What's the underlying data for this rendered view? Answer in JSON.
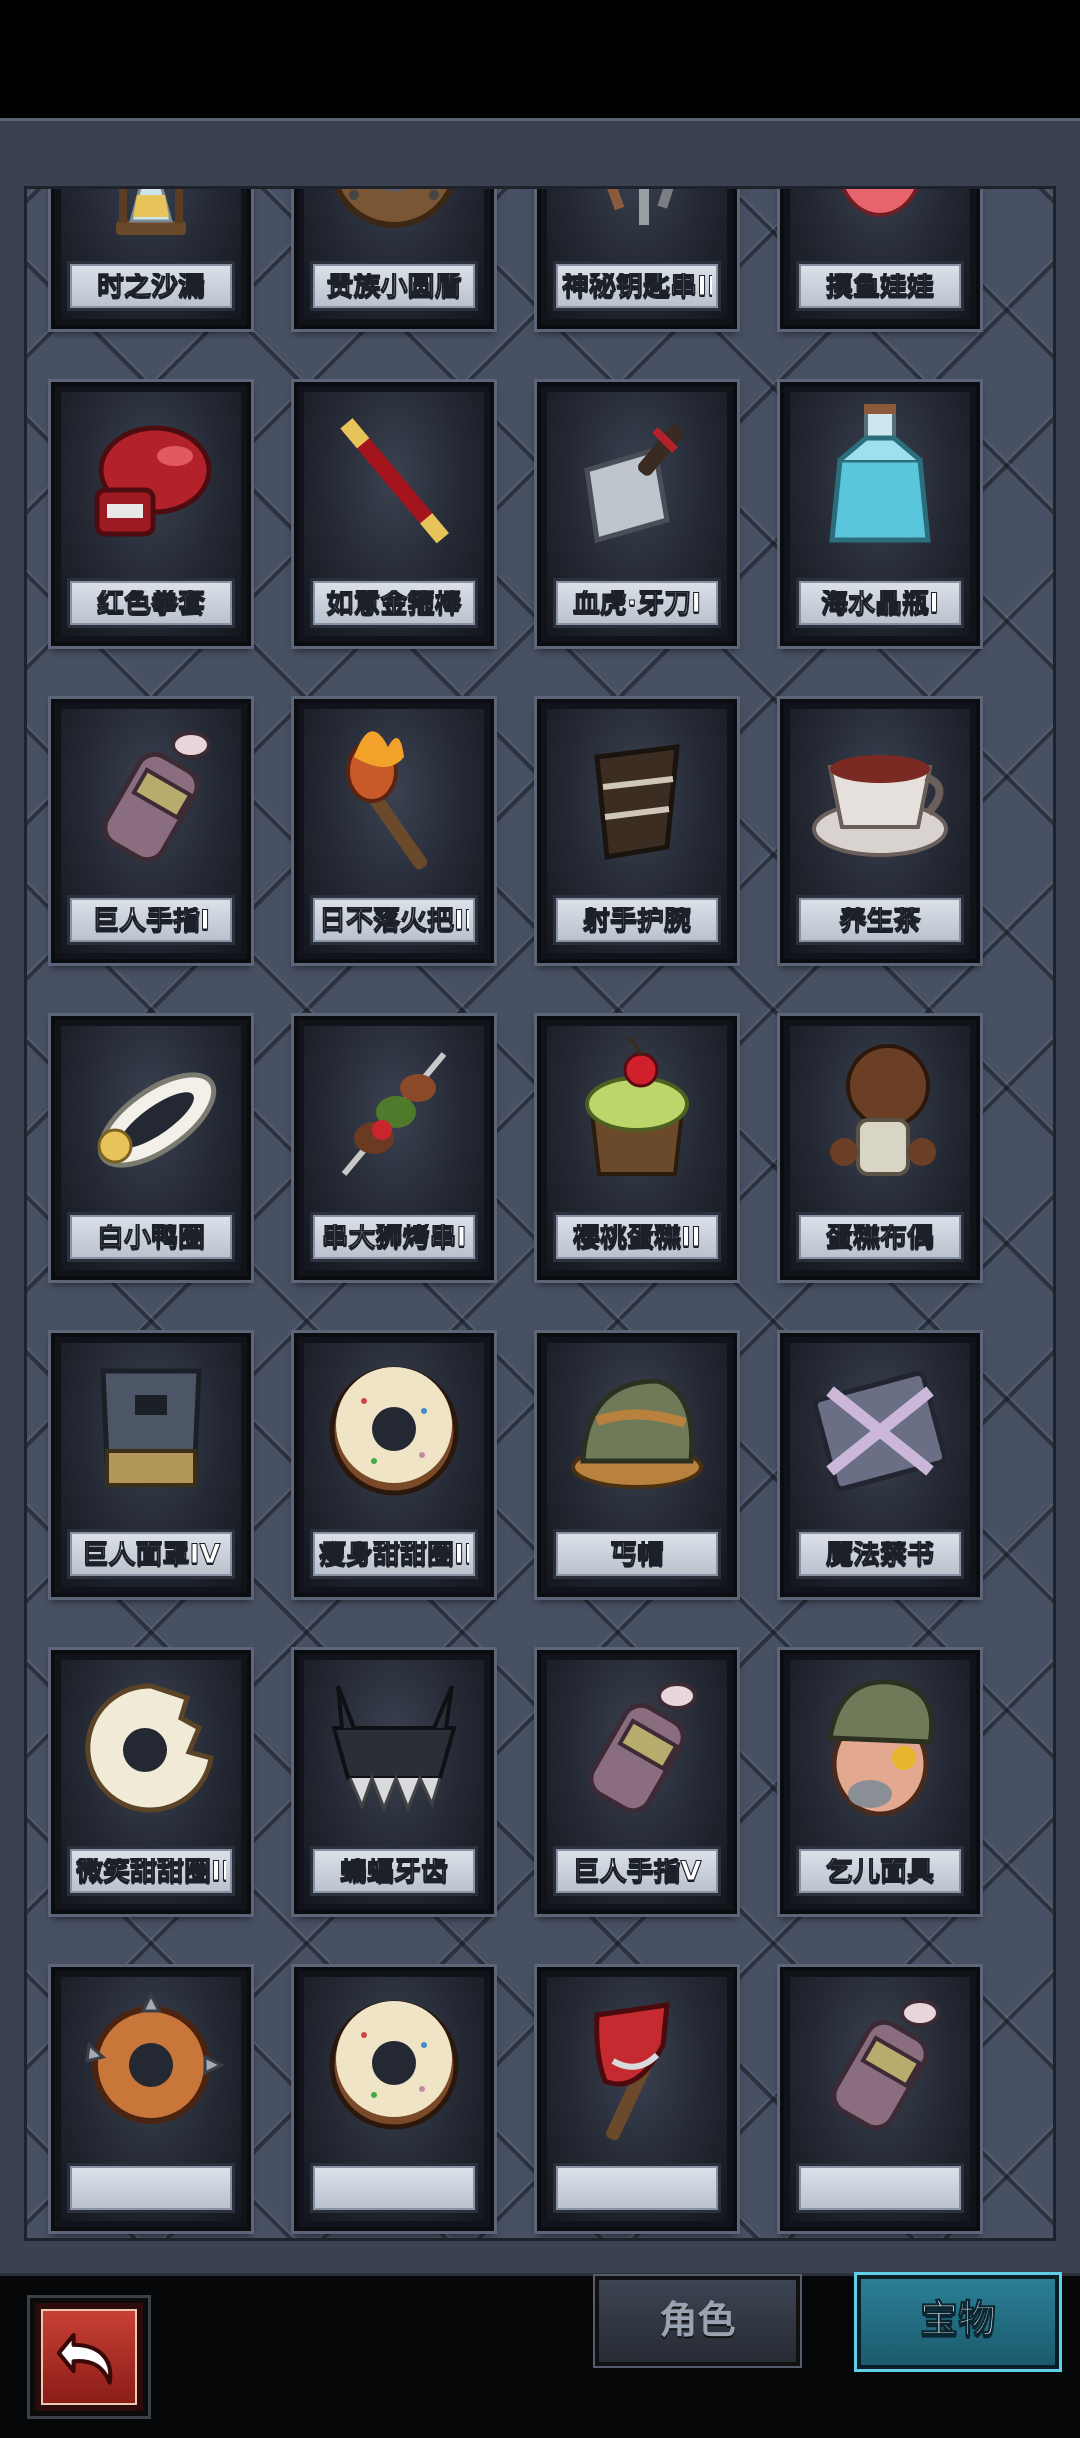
{
  "items": [
    {
      "name": "时之沙漏",
      "icon": "hourglass-icon"
    },
    {
      "name": "贵族小圆盾",
      "icon": "round-shield-icon"
    },
    {
      "name": "神秘钥匙串II",
      "icon": "key-ring-icon"
    },
    {
      "name": "摸鱼娃娃",
      "icon": "pink-doll-icon"
    },
    {
      "name": "红色拳套",
      "icon": "boxing-glove-icon"
    },
    {
      "name": "如意金箍棒",
      "icon": "staff-icon"
    },
    {
      "name": "血虎·牙刀I",
      "icon": "cleaver-icon"
    },
    {
      "name": "海水晶瓶I",
      "icon": "potion-bottle-icon"
    },
    {
      "name": "巨人手指I",
      "icon": "giant-finger-icon"
    },
    {
      "name": "日不落火把II",
      "icon": "torch-icon"
    },
    {
      "name": "射手护腕",
      "icon": "bracer-icon"
    },
    {
      "name": "养生茶",
      "icon": "teacup-icon"
    },
    {
      "name": "白小鸭圈",
      "icon": "duck-ring-icon"
    },
    {
      "name": "串大狮烤串I",
      "icon": "skewer-icon"
    },
    {
      "name": "樱桃蛋糕II",
      "icon": "cherry-cake-icon"
    },
    {
      "name": "蛋糕布偶",
      "icon": "cake-doll-icon"
    },
    {
      "name": "巨人面罩IV",
      "icon": "giant-mask-icon"
    },
    {
      "name": "瘦身甜甜圈II",
      "icon": "donut-icon"
    },
    {
      "name": "丐帽",
      "icon": "beggar-hat-icon"
    },
    {
      "name": "魔法禁书",
      "icon": "forbidden-book-icon"
    },
    {
      "name": "微笑甜甜圈II",
      "icon": "bitten-donut-icon"
    },
    {
      "name": "蝙蝠牙齿",
      "icon": "bat-teeth-icon"
    },
    {
      "name": "巨人手指V",
      "icon": "giant-finger-icon"
    },
    {
      "name": "乞儿面具",
      "icon": "beggar-mask-icon"
    },
    {
      "name": "",
      "icon": "spiked-ring-icon"
    },
    {
      "name": "",
      "icon": "donut-icon"
    },
    {
      "name": "",
      "icon": "axe-icon"
    },
    {
      "name": "",
      "icon": "giant-finger-icon"
    }
  ],
  "tabs": {
    "character": "角色",
    "treasure": "宝物",
    "active": "treasure"
  },
  "back_button": {
    "icon": "return-arrow-icon"
  }
}
